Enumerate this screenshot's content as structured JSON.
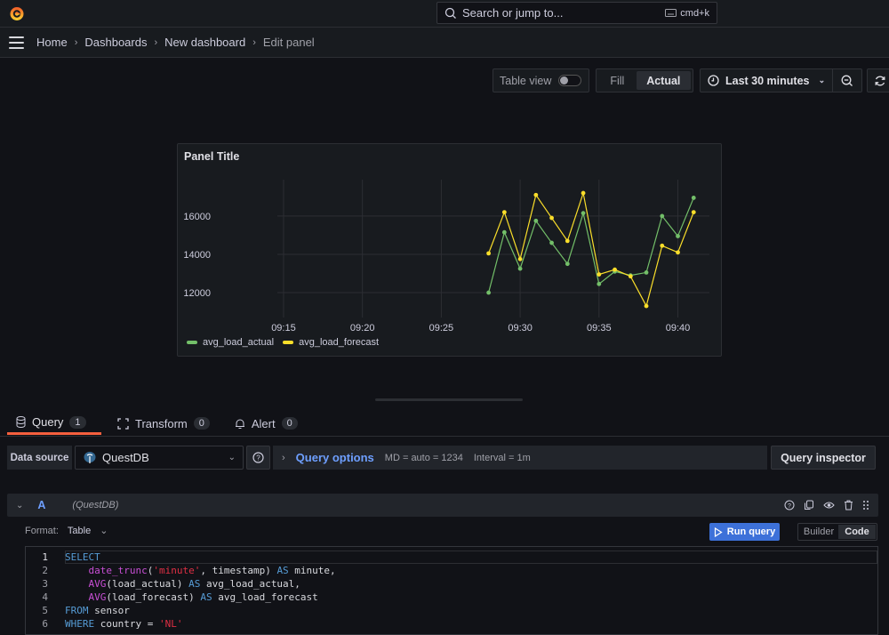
{
  "topbar": {
    "search_placeholder": "Search or jump to...",
    "shortcut": "cmd+k"
  },
  "breadcrumb": [
    "Home",
    "Dashboards",
    "New dashboard",
    "Edit panel"
  ],
  "toolbar": {
    "table_view_label": "Table view",
    "table_view_on": false,
    "fill_label": "Fill",
    "actual_label": "Actual",
    "time_range": "Last 30 minutes"
  },
  "panel": {
    "title": "Panel Title"
  },
  "chart_data": {
    "type": "line",
    "title": "Panel Title",
    "xlabel": "",
    "ylabel": "",
    "x_ticks": [
      "09:15",
      "09:20",
      "09:25",
      "09:30",
      "09:35",
      "09:40"
    ],
    "y_ticks": [
      12000,
      14000,
      16000
    ],
    "x_range": [
      "09:11",
      "09:42"
    ],
    "ylim": [
      10700,
      17900
    ],
    "grid": true,
    "legend": "bottom-left",
    "x": [
      "09:28",
      "09:29",
      "09:30",
      "09:31",
      "09:32",
      "09:33",
      "09:34",
      "09:35",
      "09:36",
      "09:37",
      "09:38",
      "09:39",
      "09:40",
      "09:41"
    ],
    "series": [
      {
        "name": "avg_load_actual",
        "color": "#73bf69",
        "values": [
          12000,
          15150,
          13250,
          15750,
          14600,
          13500,
          16150,
          12450,
          13100,
          12900,
          13050,
          16000,
          14950,
          16950
        ]
      },
      {
        "name": "avg_load_forecast",
        "color": "#fade2a",
        "values": [
          14050,
          16200,
          13750,
          17100,
          15900,
          14700,
          17200,
          12950,
          13200,
          12850,
          11300,
          14450,
          14100,
          16200
        ]
      }
    ]
  },
  "tabs": [
    {
      "label": "Query",
      "count": "1",
      "active": true
    },
    {
      "label": "Transform",
      "count": "0",
      "active": false
    },
    {
      "label": "Alert",
      "count": "0",
      "active": false
    }
  ],
  "datasource": {
    "label": "Data source",
    "value": "QuestDB",
    "query_options_label": "Query options",
    "md": "MD = auto = 1234",
    "interval": "Interval = 1m",
    "inspector_label": "Query inspector"
  },
  "query": {
    "ref_id": "A",
    "datasource_name": "(QuestDB)",
    "format_label": "Format:",
    "format_value": "Table",
    "run_label": "Run query",
    "builder_label": "Builder",
    "code_label": "Code",
    "lines": [
      {
        "n": "1",
        "text": "SELECT"
      },
      {
        "n": "2",
        "text": "    date_trunc('minute', timestamp) AS minute,"
      },
      {
        "n": "3",
        "text": "    AVG(load_actual) AS avg_load_actual,"
      },
      {
        "n": "4",
        "text": "    AVG(load_forecast) AS avg_load_forecast"
      },
      {
        "n": "5",
        "text": "FROM sensor"
      },
      {
        "n": "6",
        "text": "WHERE country = 'NL'"
      }
    ]
  }
}
